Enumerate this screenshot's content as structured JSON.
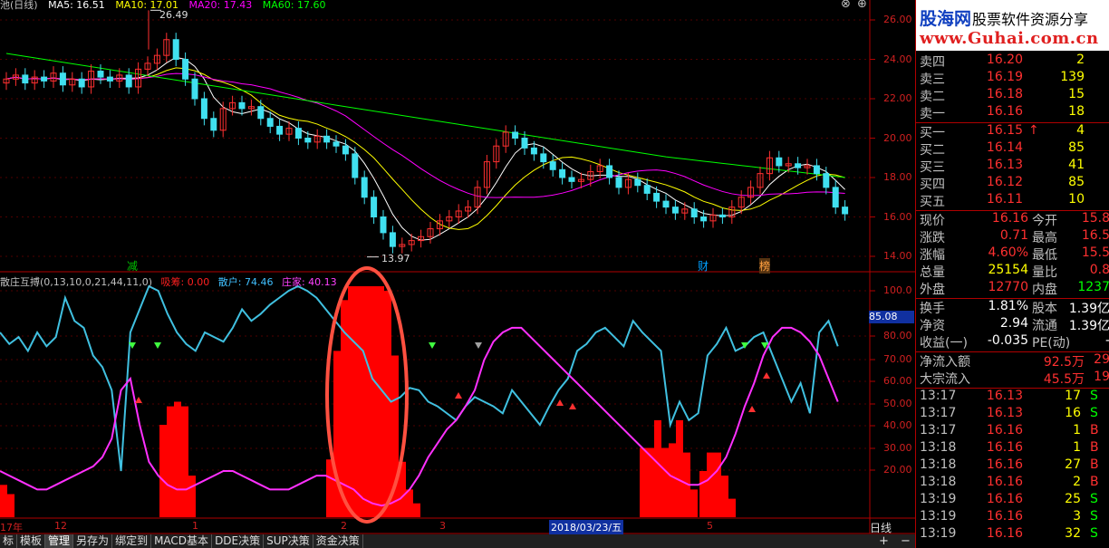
{
  "header": {
    "title_fragment": "池(日线)",
    "ma_legend": [
      {
        "label": "MA5: 16.51",
        "color": "#ffffff"
      },
      {
        "label": "MA10: 17.01",
        "color": "#ffff00"
      },
      {
        "label": "MA20: 17.43",
        "color": "#ff00ff"
      },
      {
        "label": "MA60: 17.60",
        "color": "#00ff00"
      }
    ],
    "window_buttons": [
      "⊗",
      "⊕"
    ]
  },
  "price_axis": [
    "26.00",
    "24.00",
    "22.00",
    "20.00",
    "18.00",
    "16.00",
    "14.00"
  ],
  "price_markers": {
    "high": "26.49",
    "low": "13.97"
  },
  "event_tags": [
    {
      "text": "减",
      "color": "#00c000"
    },
    {
      "text": "财",
      "color": "#00a0ff"
    },
    {
      "text": "榜",
      "color": "#ffa040"
    }
  ],
  "indicator": {
    "name": "散庄互搏(0,13,10,0,21,44,11,0)",
    "legend": [
      {
        "label": "吸筹: 0.00",
        "color": "#ff2020"
      },
      {
        "label": "散户: 74.46",
        "color": "#40c0ff"
      },
      {
        "label": "庄家: 40.13",
        "color": "#ff40ff"
      }
    ],
    "axis": [
      "100.0",
      "80.00",
      "70.00",
      "60.00",
      "50.00",
      "40.00",
      "30.00",
      "20.00"
    ],
    "cursor_value": "85.08"
  },
  "time_axis": {
    "labels": [
      "17年",
      "12",
      "1",
      "2",
      "3",
      "5"
    ],
    "cursor_date": "2018/03/23/五",
    "period": "日线"
  },
  "tabs": [
    "标",
    "模板",
    "管理",
    "另存为",
    "绑定到",
    "MACD基本",
    "DDE决策",
    "SUP决策",
    "资金决策"
  ],
  "active_tab": "管理",
  "right_panel": {
    "logo": {
      "brand": "股海网",
      "tagline": "股票软件资源分享",
      "url": "www.Guhai.com.cn"
    },
    "asks": [
      {
        "label": "卖四",
        "price": "16.20",
        "vol": "2"
      },
      {
        "label": "卖三",
        "price": "16.19",
        "vol": "139"
      },
      {
        "label": "卖二",
        "price": "16.18",
        "vol": "15"
      },
      {
        "label": "卖一",
        "price": "16.16",
        "vol": "18"
      }
    ],
    "bids": [
      {
        "label": "买一",
        "price": "16.15",
        "arrow": "↑",
        "vol": "4"
      },
      {
        "label": "买二",
        "price": "16.14",
        "vol": "85"
      },
      {
        "label": "买三",
        "price": "16.13",
        "vol": "41"
      },
      {
        "label": "买四",
        "price": "16.12",
        "vol": "85"
      },
      {
        "label": "买五",
        "price": "16.11",
        "vol": "10"
      }
    ],
    "stats": [
      {
        "l1": "现价",
        "v1": "16.16",
        "l2": "今开",
        "v2": "15.8",
        "c1": "#ff3030",
        "c2": "#ff3030"
      },
      {
        "l1": "涨跌",
        "v1": "0.71",
        "l2": "最高",
        "v2": "16.5",
        "c1": "#ff3030",
        "c2": "#ff3030"
      },
      {
        "l1": "涨幅",
        "v1": "4.60%",
        "l2": "最低",
        "v2": "15.5",
        "c1": "#ff3030",
        "c2": "#ff3030"
      },
      {
        "l1": "总量",
        "v1": "25154",
        "l2": "量比",
        "v2": "0.8",
        "c1": "#ffff00",
        "c2": "#ff3030"
      },
      {
        "l1": "外盘",
        "v1": "12770",
        "l2": "内盘",
        "v2": "1237",
        "c1": "#ff3030",
        "c2": "#00ff00"
      }
    ],
    "stats2": [
      {
        "l1": "换手",
        "v1": "1.81%",
        "l2": "股本",
        "v2": "1.39亿"
      },
      {
        "l1": "净资",
        "v1": "2.94",
        "l2": "流通",
        "v2": "1.39亿"
      },
      {
        "l1": "收益(一)",
        "v1": "-0.035",
        "l2": "PE(动)",
        "v2": "-"
      }
    ],
    "flows": [
      {
        "label": "净流入额",
        "value": "92.5万",
        "extra": "29"
      },
      {
        "label": "大宗流入",
        "value": "45.5万",
        "extra": "19"
      }
    ],
    "ticks": [
      {
        "time": "13:17",
        "price": "16.13",
        "vol": "17",
        "side": "S"
      },
      {
        "time": "13:17",
        "price": "16.13",
        "vol": "16",
        "side": "S"
      },
      {
        "time": "13:17",
        "price": "16.16",
        "vol": "1",
        "side": "B"
      },
      {
        "time": "13:18",
        "price": "16.16",
        "vol": "1",
        "side": "B"
      },
      {
        "time": "13:18",
        "price": "16.16",
        "vol": "27",
        "side": "B"
      },
      {
        "time": "13:18",
        "price": "16.16",
        "vol": "2",
        "side": "B"
      },
      {
        "time": "13:19",
        "price": "16.16",
        "vol": "25",
        "side": "S"
      },
      {
        "time": "13:19",
        "price": "16.16",
        "vol": "3",
        "side": "S"
      },
      {
        "time": "13:19",
        "price": "16.16",
        "vol": "32",
        "side": "S"
      }
    ]
  }
}
